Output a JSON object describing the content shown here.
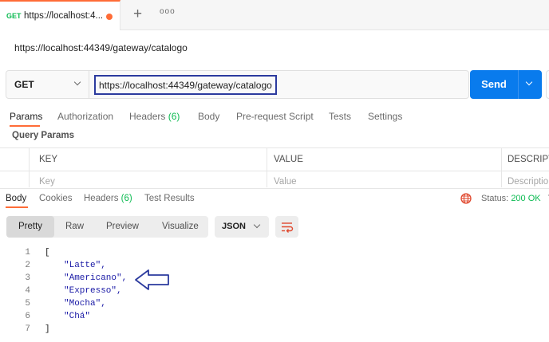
{
  "tab": {
    "method": "GET",
    "title": "https://localhost:44349/gateway/catalogo"
  },
  "tab_title_display": "https://localhost:4...",
  "plus_symbol": "+",
  "more_symbol": "ooo",
  "request_name": "https://localhost:44349/gateway/catalogo",
  "request": {
    "method": "GET",
    "url": "https://localhost:44349/gateway/catalogo",
    "send_label": "Send"
  },
  "request_tabs": [
    {
      "label": "Params"
    },
    {
      "label": "Authorization"
    },
    {
      "label": "Headers",
      "count": "(6)"
    },
    {
      "label": "Body"
    },
    {
      "label": "Pre-request Script"
    },
    {
      "label": "Tests"
    },
    {
      "label": "Settings"
    }
  ],
  "query_params": {
    "title": "Query Params",
    "columns": [
      "KEY",
      "VALUE",
      "DESCRIPT"
    ],
    "placeholders": [
      "Key",
      "Value",
      "Descriptio"
    ]
  },
  "response_tabs": [
    {
      "label": "Body"
    },
    {
      "label": "Cookies"
    },
    {
      "label": "Headers",
      "count": "(6)"
    },
    {
      "label": "Test Results"
    }
  ],
  "status": {
    "label": "Status:",
    "code": "200 OK",
    "cut": "T"
  },
  "view_modes": [
    "Pretty",
    "Raw",
    "Preview",
    "Visualize"
  ],
  "format": "JSON",
  "colors": {
    "accent": "#ff6c37",
    "send": "#097bed",
    "success": "#0cbb52",
    "highlight_box": "#2b3a9e",
    "string": "#1a1aa6"
  },
  "code_lines": [
    {
      "n": "1",
      "text": "["
    },
    {
      "n": "2",
      "text": "\"Latte\","
    },
    {
      "n": "3",
      "text": "\"Americano\","
    },
    {
      "n": "4",
      "text": "\"Expresso\","
    },
    {
      "n": "5",
      "text": "\"Mocha\","
    },
    {
      "n": "6",
      "text": "\"Chá\""
    },
    {
      "n": "7",
      "text": "]"
    }
  ]
}
